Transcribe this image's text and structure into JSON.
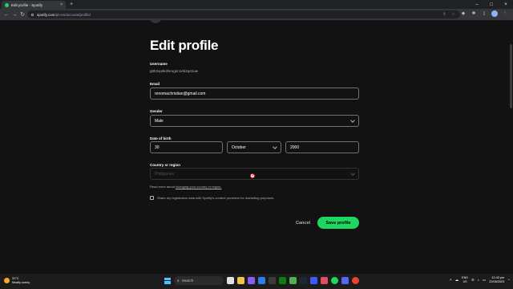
{
  "browser": {
    "tab_title": "Edit profile - Spotify",
    "tab_close": "×",
    "new_tab": "+",
    "url_domain": "spotify.com",
    "url_path": "/ph-en/account/profile/",
    "window_controls": [
      "–",
      "□",
      "×"
    ]
  },
  "profile": {
    "title": "Edit profile",
    "username_label": "Username",
    "username_value": "g6h2vp2k2lsrugen1eb2q41uw",
    "email_label": "Email",
    "email_value": "renomachristian@gmail.com",
    "gender_label": "Gender",
    "gender_value": "Male",
    "dob_label": "Date of birth",
    "dob_day": "30",
    "dob_month": "October",
    "dob_year": "2000",
    "country_label": "Country or region",
    "country_value": "Philippines",
    "helper_prefix": "Read more about ",
    "helper_link": "changing your country or region.",
    "share_label": "Share my registration data with Spotify's content providers for marketing purposes.",
    "share_checked": false,
    "cancel_label": "Cancel",
    "save_label": "Save profile"
  },
  "taskbar": {
    "temperature": "31°C",
    "weather_condition": "Mostly sunny",
    "search_placeholder": "Search",
    "language": "ENG",
    "region": "US",
    "time": "12:43 pm",
    "date": "22/08/2023"
  },
  "colors": {
    "accent": "#1ed760",
    "background": "#121212",
    "field_border": "#727272",
    "cursor_ring": "#e22134"
  }
}
